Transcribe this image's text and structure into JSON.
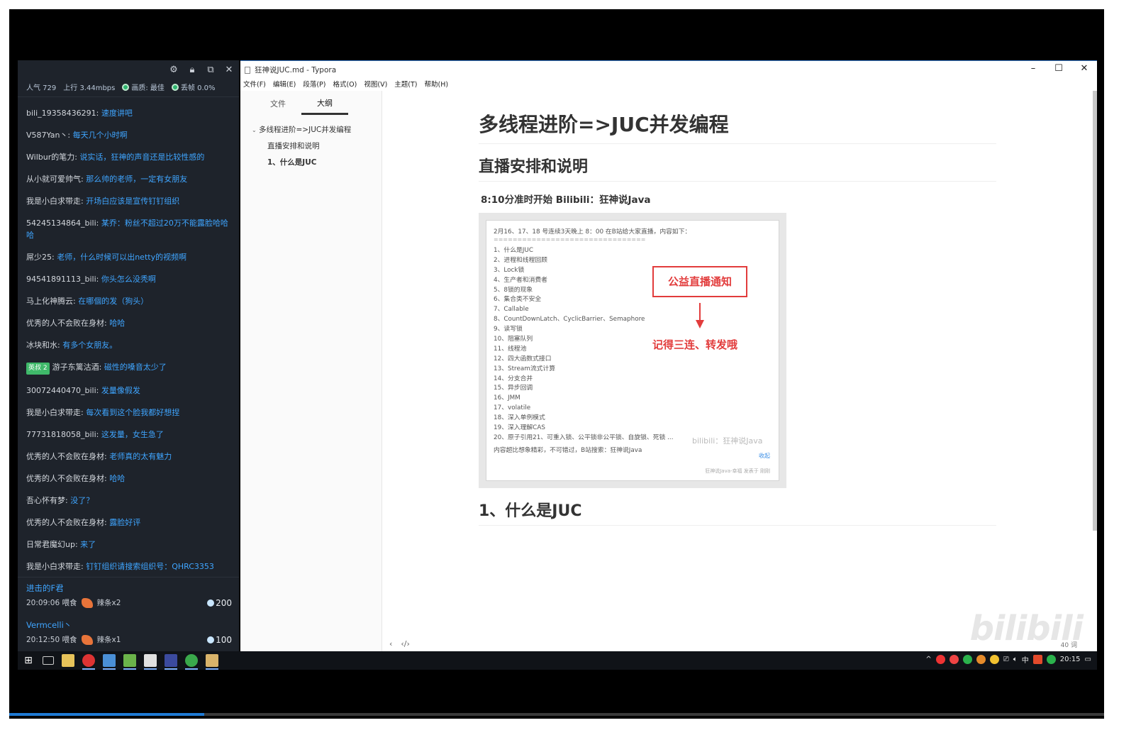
{
  "chat": {
    "header_icons": [
      "gear-icon",
      "lock-icon",
      "popout-icon",
      "close-icon"
    ],
    "stats": {
      "popularity": "人气 729",
      "upload": "上行 3.44mbps",
      "quality": "画质: 最佳",
      "dropped": "丢帧 0.0%"
    },
    "messages": [
      {
        "user": "bili_19358436291:",
        "text": "速度讲吧"
      },
      {
        "user": "V587Yan丶:",
        "text": "每天几个小时啊"
      },
      {
        "user": "Wilbur的笔力:",
        "text": "说实话，狂神的声音还是比较性感的"
      },
      {
        "user": "从小就可爱帅气:",
        "text": "那么帅的老师，一定有女朋友"
      },
      {
        "user": "我是小白求带走:",
        "text": "开场白应该是宣传钉钉组织"
      },
      {
        "user": "54245134864_bili:",
        "text": "某乔：粉丝不超过20万不能露脸哈哈哈"
      },
      {
        "user": "屌少25:",
        "text": "老师，什么时候可以出netty的视频啊"
      },
      {
        "user": "94541891113_bili:",
        "text": "你头怎么没秃啊"
      },
      {
        "user": "马上化神腾云:",
        "text": "在哪個的发（狗头）"
      },
      {
        "user": "优秀的人不会败在身材:",
        "text": "哈哈"
      },
      {
        "user": "冰块和水:",
        "text": "有多个女朋友。"
      },
      {
        "badge": "英叔 2",
        "user": "游子东篱沽酒:",
        "text": "磁性的嗓音太少了"
      },
      {
        "user": "30072440470_bili:",
        "text": "发量像假发"
      },
      {
        "user": "我是小白求带走:",
        "text": "每次看到这个脸我都好想捏"
      },
      {
        "user": "77731818058_bili:",
        "text": "这发量，女生急了"
      },
      {
        "user": "优秀的人不会败在身材:",
        "text": "老师真的太有魅力"
      },
      {
        "user": "优秀的人不会败在身材:",
        "text": "哈哈"
      },
      {
        "user": "吾心怀有梦:",
        "text": "没了？"
      },
      {
        "user": "优秀的人不会败在身材:",
        "text": "露脸好评"
      },
      {
        "user": "日常君魔幻up:",
        "text": "来了"
      },
      {
        "user": "我是小白求带走:",
        "text": "钉钉组织请搜索组织号：QHRC3353"
      }
    ],
    "gifts": [
      {
        "name": "进击的F君",
        "time": "20:09:06 喂食",
        "item": "辣条x2",
        "count": "200"
      },
      {
        "name": "Vermcelli丶",
        "time": "20:12:50 喂食",
        "item": "辣条x1",
        "count": "100"
      }
    ]
  },
  "typora": {
    "window_title": "狂神说JUC.md - Typora",
    "window_controls": [
      "minimize-icon",
      "maximize-icon",
      "close-icon"
    ],
    "menu": [
      "文件(F)",
      "编辑(E)",
      "段落(P)",
      "格式(O)",
      "视图(V)",
      "主题(T)",
      "帮助(H)"
    ],
    "sidebar": {
      "tabs": [
        "文件",
        "大纲"
      ],
      "active_tab": "大纲",
      "outline": [
        {
          "label": "多线程进阶=>JUC并发编程",
          "level": 1
        },
        {
          "label": "直播安排和说明",
          "level": 2
        },
        {
          "label": "1、什么是JUC",
          "level": 2
        }
      ]
    },
    "document": {
      "h1": "多线程进阶=>JUC并发编程",
      "h2_schedule": "直播安排和说明",
      "h3_time": "8:10分准时开始  Bilibili：狂神说Java",
      "h2_juc": "1、什么是JUC"
    },
    "poster": {
      "header": "2月16、17、18 号连续3天晚上 8：00 在B站给大家直播，内容如下：",
      "separator": "================================",
      "items": [
        "1、什么是JUC",
        "2、进程和线程回顾",
        "3、Lock锁",
        "4、生产者和消费者",
        "5、8锁的现象",
        "6、集合类不安全",
        "7、Callable",
        "8、CountDownLatch、CyclicBarrier、Semaphore",
        "9、读写锁",
        "10、阻塞队列",
        "11、线程池",
        "12、四大函数式接口",
        "13、Stream流式计算",
        "14、分支合并",
        "15、异步回调",
        "16、JMM",
        "17、volatile",
        "18、深入单例模式",
        "19、深入理解CAS",
        "20、原子引用21、可重入锁、公平锁非公平锁、自旋锁、死锁 ..."
      ],
      "footer": "内容超比想象精彩，不可错过，B站搜索：狂神说Java",
      "notice": "公益直播通知",
      "reminder": "记得三连、转发哦",
      "watermark": "bilibili：狂神说Java",
      "fold": "收起",
      "credit": "狂神说Java-幸福 发表于 刚刚"
    },
    "status": {
      "word_count": "40 词"
    },
    "watermark": "bilibili"
  },
  "taskbar": {
    "apps": [
      "windows-start-icon",
      "task-view-icon",
      "file-explorer-icon",
      "red-app-icon",
      "browser-icon",
      "editor-icon",
      "typora-icon",
      "ide-icon",
      "green-app-icon",
      "folder-app-icon"
    ],
    "active_app": "typora-icon",
    "tray": {
      "ime": "中",
      "time": "20:15"
    }
  }
}
